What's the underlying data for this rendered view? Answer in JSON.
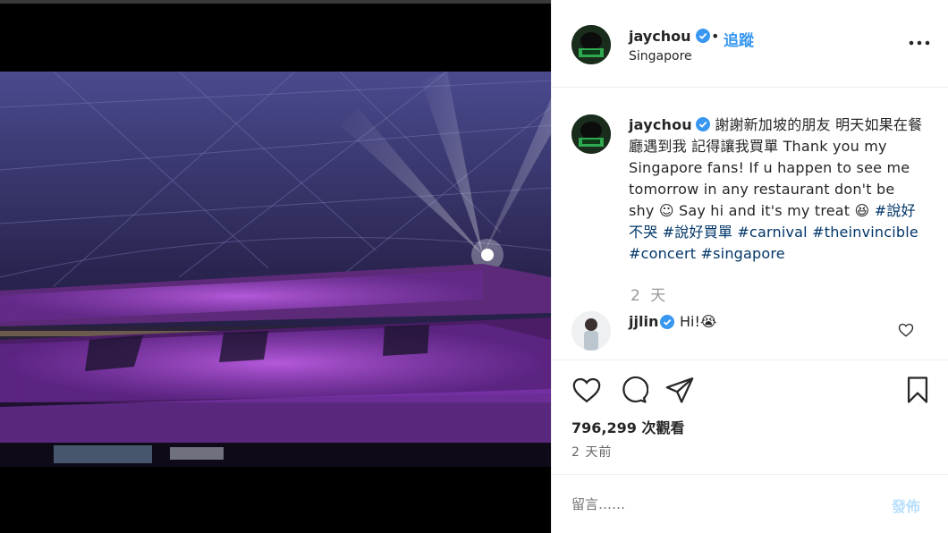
{
  "header": {
    "username": "jaychou",
    "dot": "•",
    "follow_label": "追蹤",
    "location": "Singapore"
  },
  "caption": {
    "username": "jaychou",
    "text": "謝謝新加坡的朋友 明天如果在餐廳遇到我 記得讓我買單 Thank you my Singapore fans! If u happen to see me tomorrow in any restaurant don't be shy ☺ Say hi and it's my treat 😆 ",
    "hashtags": [
      "#說好不哭",
      "#說好買單",
      "#carnival",
      "#theinvincible",
      "#concert",
      "#singapore"
    ],
    "time": "2 天"
  },
  "comment": {
    "username": "jjlin",
    "text": "Hi!😭"
  },
  "stats": {
    "views": "796,299 次觀看",
    "posted": "2 天前"
  },
  "comment_box": {
    "placeholder": "留言……",
    "post_label": "發佈"
  },
  "colors": {
    "accent": "#3897f0",
    "hashtag": "#003569",
    "verified": "#3897f0",
    "post_disabled": "#b9dffc"
  },
  "icons": [
    "verified-badge-icon",
    "more-options-icon",
    "heart-icon",
    "comment-icon",
    "share-icon",
    "bookmark-icon"
  ]
}
